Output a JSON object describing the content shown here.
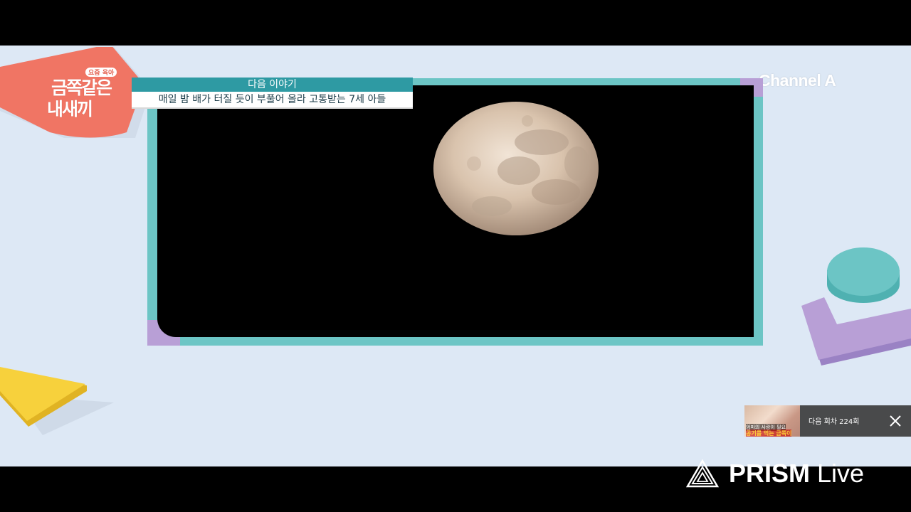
{
  "show": {
    "logo_small": "요즘 육아",
    "logo_line1": "금쪽같은",
    "logo_line2": "내새끼"
  },
  "channel": {
    "name": "Channel A"
  },
  "next_story": {
    "title": "다음 이야기",
    "description": "매일 밤 배가 터질 듯이 부풀어 올라 고통받는 7세 아들"
  },
  "up_next": {
    "label": "다음 회차 224회",
    "thumb_line1": "엄마의 사랑이 필요",
    "thumb_line2": "공기를 먹는 금쪽이",
    "close_icon": "close-icon"
  },
  "watermark": {
    "brand_bold": "PRISM",
    "brand_light": "Live"
  },
  "colors": {
    "background": "#dde8f5",
    "frame": "#6cc5c5",
    "accent_purple": "#b89fd6",
    "accent_coral": "#f07564",
    "accent_yellow": "#f7d13c",
    "banner_teal": "#2e9aa3"
  }
}
